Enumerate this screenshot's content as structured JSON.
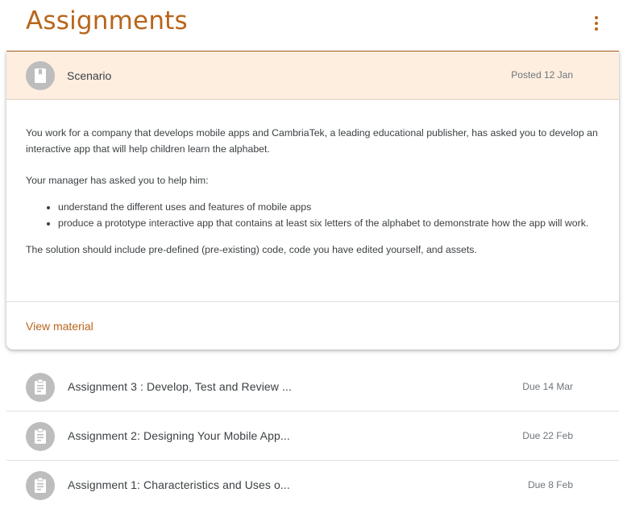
{
  "header": {
    "title": "Assignments"
  },
  "scenario": {
    "title": "Scenario",
    "posted": "Posted 12 Jan",
    "para1": "You work for a company that develops mobile apps and CambriaTek, a leading educational publisher, has asked you to develop an interactive app that will help children learn the alphabet.",
    "para2": "Your manager has asked you to help him:",
    "bullets": [
      "understand the different uses and features of mobile apps",
      "produce a prototype interactive app that contains at least six letters of the alphabet to demonstrate how the app will work."
    ],
    "para3": "The solution should include pre-defined (pre-existing) code, code you have edited yourself, and assets.",
    "view_material": "View material"
  },
  "assignments": [
    {
      "title": "Assignment 3 : Develop, Test and Review ...",
      "due": "Due 14 Mar"
    },
    {
      "title": "Assignment 2: Designing Your Mobile App...",
      "due": "Due 22 Feb"
    },
    {
      "title": "Assignment 1: Characteristics and Uses o...",
      "due": "Due 8 Feb"
    }
  ],
  "colors": {
    "accent": "#b8651b",
    "header_bg": "#fdeee0",
    "icon_bg": "#bdbdbd"
  },
  "icons": {
    "more": "more-vert-icon",
    "material": "book-icon",
    "assignment": "clipboard-icon"
  }
}
